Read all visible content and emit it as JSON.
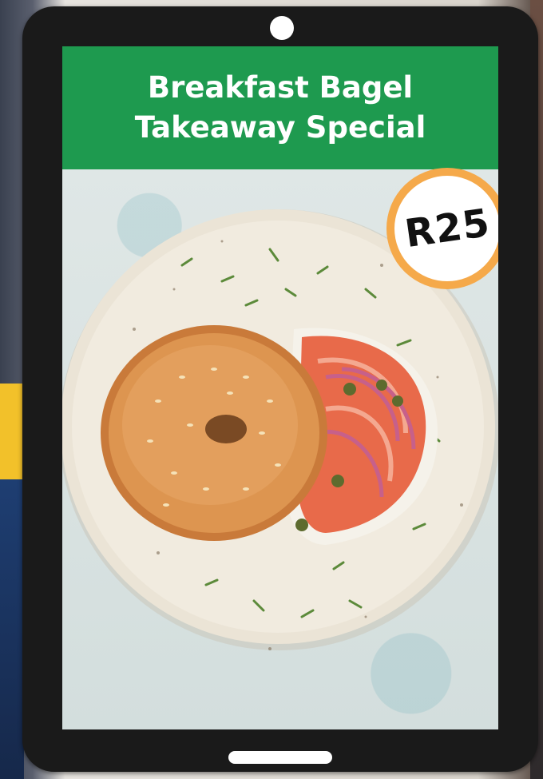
{
  "header": {
    "title": "Breakfast Bagel Takeaway Special"
  },
  "price_badge": {
    "text": "R25"
  },
  "colors": {
    "header_bg": "#1e9a4f",
    "badge_ring": "#f5a94a",
    "tablet_frame": "#1a1a1a",
    "text_light": "#ffffff"
  },
  "icons": {
    "camera": "camera-dot-icon",
    "home": "home-bar-icon"
  }
}
